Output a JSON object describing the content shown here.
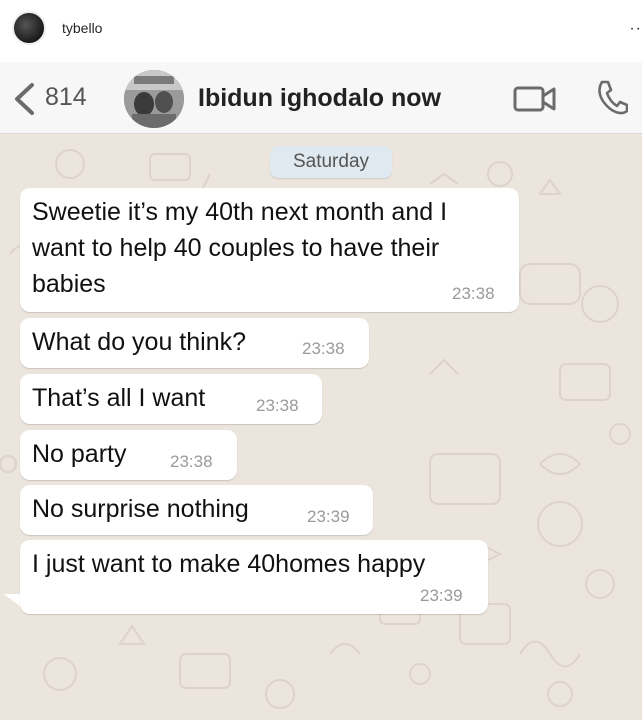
{
  "post": {
    "username": "tybello",
    "more": "··"
  },
  "chat_header": {
    "back_count": "814",
    "contact_name": "Ibidun ighodalo now"
  },
  "chat": {
    "date_chip": "Saturday",
    "messages": [
      {
        "lines": [
          "Sweetie it’s my 40th next month and I",
          "want to help 40 couples to have their",
          "babies"
        ],
        "time": "23:38"
      },
      {
        "lines": [
          "What do you think?"
        ],
        "time": "23:38"
      },
      {
        "lines": [
          "That’s all I want"
        ],
        "time": "23:38"
      },
      {
        "lines": [
          "No party"
        ],
        "time": "23:38"
      },
      {
        "lines": [
          "No surprise nothing"
        ],
        "time": "23:39"
      },
      {
        "lines": [
          "I just want to make 40homes happy"
        ],
        "time": "23:39"
      }
    ]
  },
  "icons": {
    "back": "chevron-left-icon",
    "video": "video-camera-icon",
    "phone": "phone-icon"
  },
  "colors": {
    "chat_background": "#ece5dd",
    "bubble": "#ffffff",
    "date_chip": "#dfe9ef",
    "header_background": "#f7f7f7",
    "timestamp": "#9a9a9a"
  }
}
